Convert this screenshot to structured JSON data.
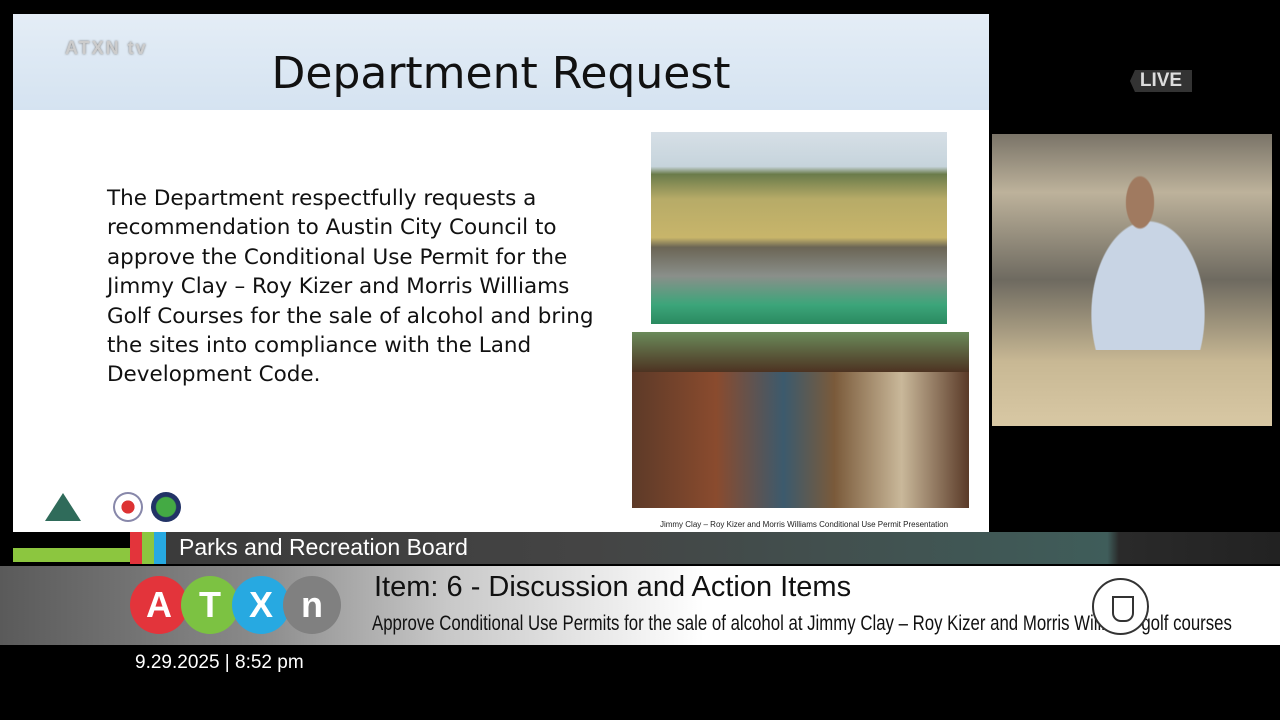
{
  "slide": {
    "watermark": "ATXN tv",
    "title": "Department Request",
    "body": "The Department respectfully requests a recommendation to Austin City Council to approve the Conditional Use Permit for the Jimmy Clay – Roy Kizer and Morris Williams Golf Courses for the sale of alcohol and bring the sites into compliance with the Land Development Code.",
    "caption": "Jimmy Clay – Roy Kizer and Morris Williams Conditional Use Permit Presentation",
    "logos": [
      "Austin Parks and Recreation",
      "City of Austin",
      "CAPRA"
    ]
  },
  "broadcast": {
    "live_label": "LIVE",
    "board_name": "Parks and Recreation Board",
    "brand_letters": [
      "A",
      "T",
      "X",
      "n"
    ],
    "brand_colors": [
      "#e3343b",
      "#7cc242",
      "#27a9e1",
      "#808080"
    ],
    "stripe_colors": [
      "#e3343b",
      "#8cc63f",
      "#27a9e1"
    ],
    "item_title": "Item: 6 - Discussion and  Action Items",
    "item_subtitle": "Approve Conditional Use Permits for the sale of alcohol at Jimmy Clay – Roy Kizer and Morris Williams golf courses",
    "datetime": "9.29.2025 | 8:52 pm"
  }
}
